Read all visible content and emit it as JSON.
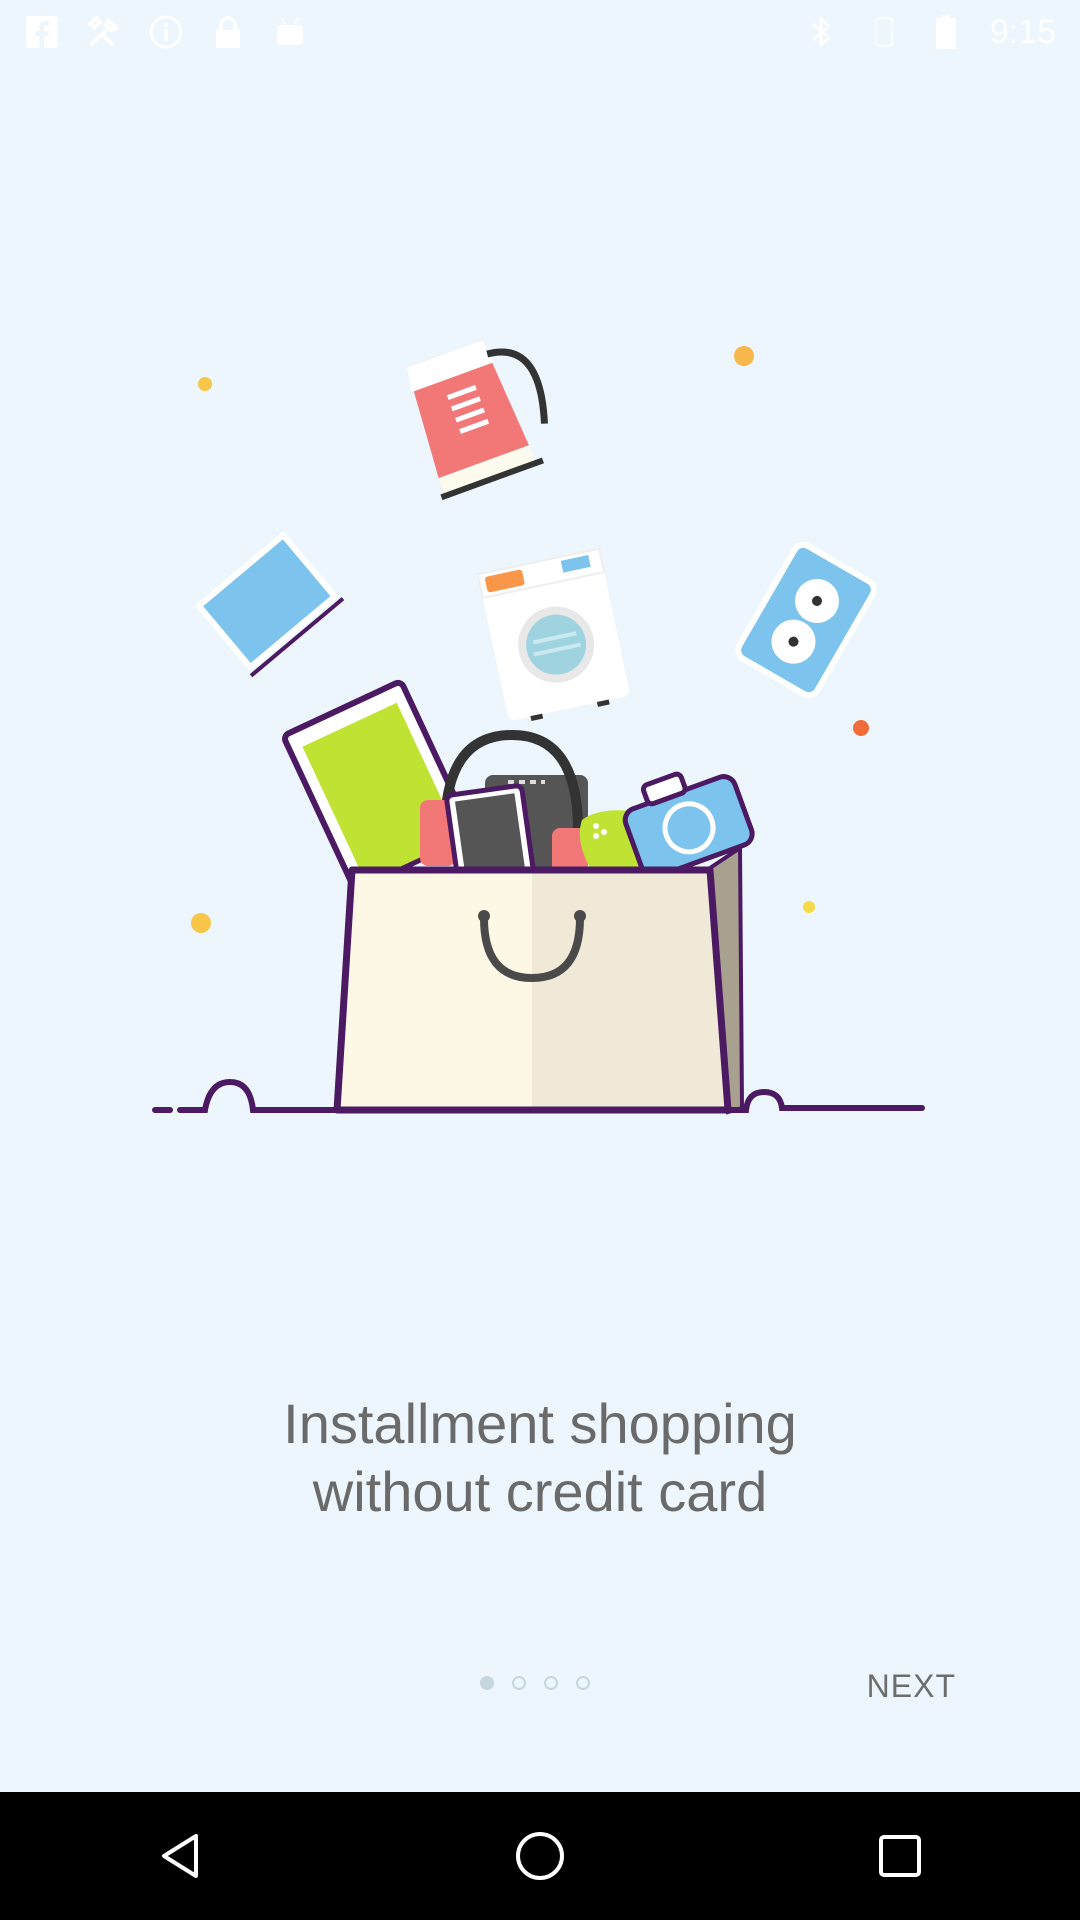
{
  "status_bar": {
    "time": "9:15",
    "left_icons": [
      "facebook-icon",
      "tools-icon",
      "info-icon",
      "lock-icon",
      "android-icon"
    ],
    "right_icons": [
      "bluetooth-icon",
      "vibrate-icon",
      "battery-icon"
    ]
  },
  "onboarding": {
    "headline_line1": "Installment shopping",
    "headline_line2": "without credit card",
    "page_count": 4,
    "current_page": 1,
    "next_label": "NEXT"
  },
  "nav_bar": {
    "buttons": [
      "back-icon",
      "home-icon",
      "recents-icon"
    ]
  },
  "colors": {
    "background": "#edf6fc",
    "headline_text": "#6a6a6a",
    "dot": "#c4d6e0",
    "bag_outline": "#4b1a63",
    "accent_blue": "#7cc3ee",
    "accent_green": "#c0e233",
    "accent_pink": "#f27878",
    "accent_orange": "#f8964a",
    "dot_yellow": "#f7c548"
  }
}
